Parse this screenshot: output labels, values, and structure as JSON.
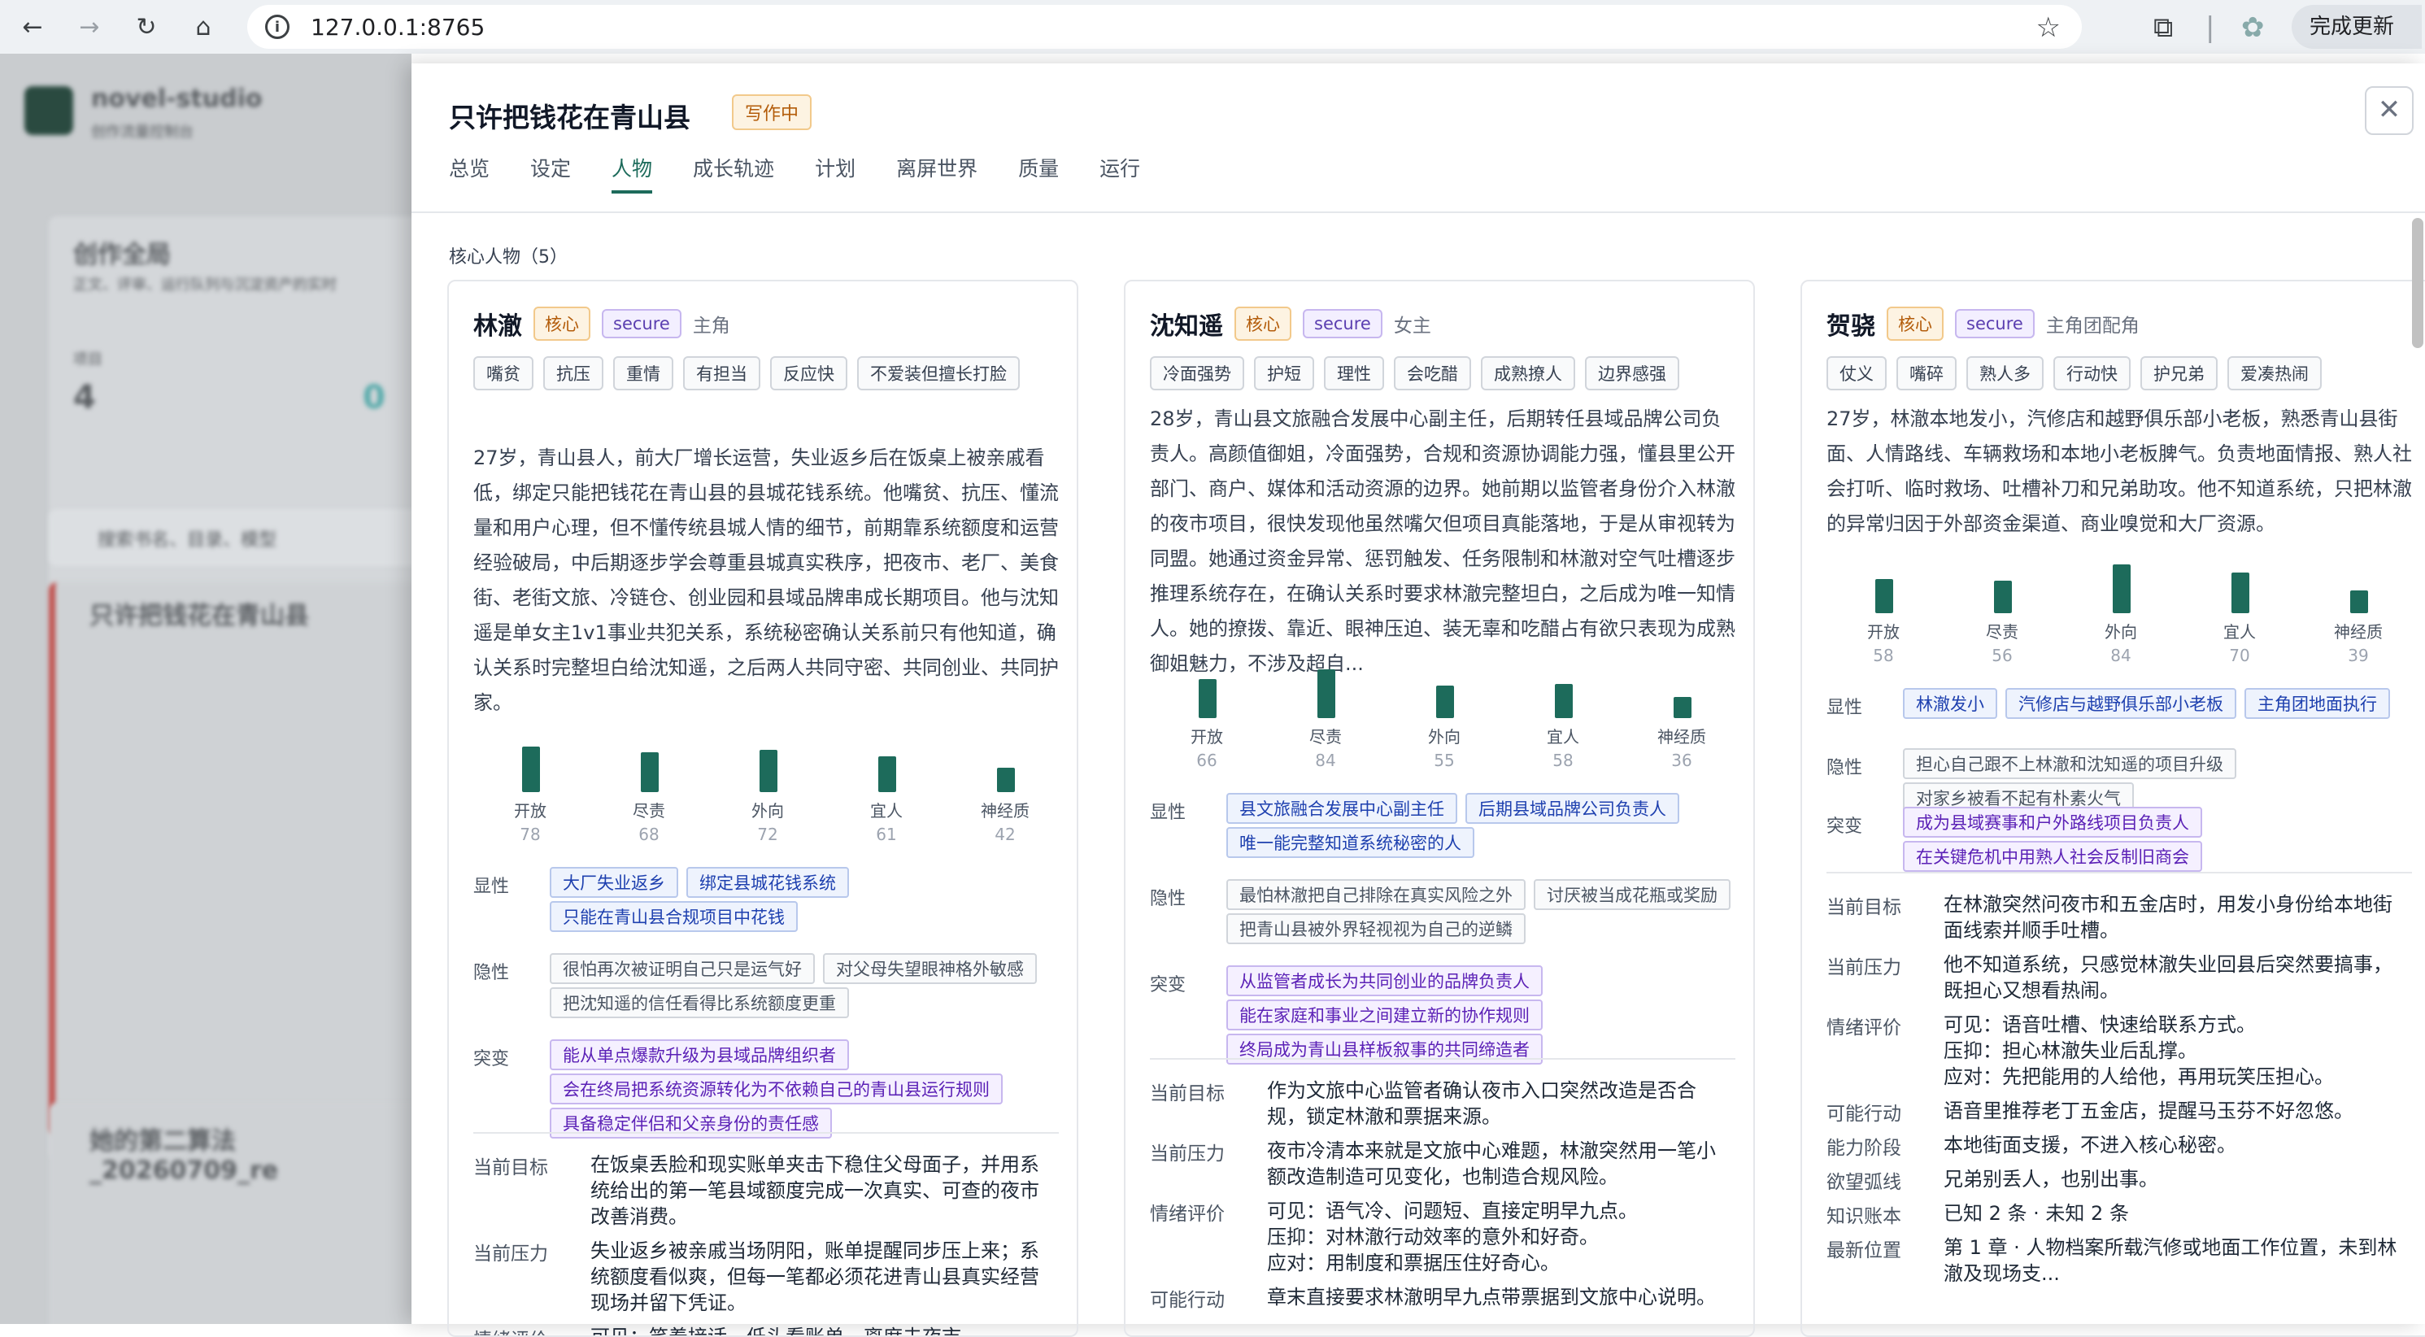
{
  "browser": {
    "url": "127.0.0.1:8765",
    "update_label": "完成更新"
  },
  "panel": {
    "title": "只许把钱花在青山县",
    "status": "写作中",
    "tabs": [
      "总览",
      "设定",
      "人物",
      "成长轨迹",
      "计划",
      "离屏世界",
      "质量",
      "运行"
    ],
    "active_tab": "人物",
    "section_title": "核心人物（5）"
  },
  "background_app": {
    "app_name": "novel-studio",
    "app_sub": "创作流量控制台",
    "section": "创作全局",
    "section_sub": "正文、评审、运行队列与沉淀资产的实时",
    "stat_label": "项目",
    "stat_value": "4",
    "stat_value2": "0",
    "search_placeholder": "搜索书名、目录、模型",
    "project1": "只许把钱花在青山县",
    "project2": "她的第二算法_20260709_re"
  },
  "characters": [
    {
      "name": "林澈",
      "core": "核心",
      "attach": "secure",
      "role": "主角",
      "tags": [
        "嘴贫",
        "抗压",
        "重情",
        "有担当",
        "反应快",
        "不爱装但擅长打脸"
      ],
      "desc": "27岁，青山县人，前大厂增长运营，失业返乡后在饭桌上被亲戚看低，绑定只能把钱花在青山县的县城花钱系统。他嘴贫、抗压、懂流量和用户心理，但不懂传统县城人情的细节，前期靠系统额度和运营经验破局，中后期逐步学会尊重县城真实秩序，把夜市、老厂、美食街、老街文旅、冷链仓、创业园和县域品牌串成长期项目。他与沈知遥是单女主1v1事业共犯关系，系统秘密确认关系前只有他知道，确认关系时完整坦白给沈知遥，之后两人共同守密、共同创业、共同护家。",
      "bars": [
        {
          "label": "开放",
          "value": 78
        },
        {
          "label": "尽责",
          "value": 68
        },
        {
          "label": "外向",
          "value": 72
        },
        {
          "label": "宜人",
          "value": 61
        },
        {
          "label": "神经质",
          "value": 42
        }
      ],
      "traits": [
        {
          "label": "显性",
          "style": "b",
          "items": [
            "大厂失业返乡",
            "绑定县城花钱系统",
            "只能在青山县合规项目中花钱"
          ]
        },
        {
          "label": "隐性",
          "style": "g",
          "items": [
            "很怕再次被证明自己只是运气好",
            "对父母失望眼神格外敏感",
            "把沈知遥的信任看得比系统额度更重"
          ]
        },
        {
          "label": "突变",
          "style": "p",
          "items": [
            "能从单点爆款升级为县域品牌组织者",
            "会在终局把系统资源转化为不依赖自己的青山县运行规则",
            "具备稳定伴侣和父亲身份的责任感"
          ]
        }
      ],
      "kv": [
        {
          "k": "当前目标",
          "v": "在饭桌丢脸和现实账单夹击下稳住父母面子，并用系统给出的第一笔县域额度完成一次真实、可查的夜市改善消费。"
        },
        {
          "k": "当前压力",
          "v": "失业返乡被亲戚当场阴阳，账单提醒同步压上来；系统额度看似爽，但每一笔都必须花进青山县真实经营现场并留下凭证。"
        },
        {
          "k": "情绪评价",
          "v": "可见：笑着接话、低头看账单、离席去夜市。"
        }
      ]
    },
    {
      "name": "沈知遥",
      "core": "核心",
      "attach": "secure",
      "role": "女主",
      "tags": [
        "冷面强势",
        "护短",
        "理性",
        "会吃醋",
        "成熟撩人",
        "边界感强"
      ],
      "desc": "28岁，青山县文旅融合发展中心副主任，后期转任县域品牌公司负责人。高颜值御姐，冷面强势，合规和资源协调能力强，懂县里公开部门、商户、媒体和活动资源的边界。她前期以监管者身份介入林澈的夜市项目，很快发现他虽然嘴欠但项目真能落地，于是从审视转为同盟。她通过资金异常、惩罚触发、任务限制和林澈对空气吐槽逐步推理系统存在，在确认关系时要求林澈完整坦白，之后成为唯一知情人。她的撩拨、靠近、眼神压迫、装无辜和吃醋占有欲只表现为成熟御姐魅力，不涉及超自...",
      "bars": [
        {
          "label": "开放",
          "value": 66
        },
        {
          "label": "尽责",
          "value": 84
        },
        {
          "label": "外向",
          "value": 55
        },
        {
          "label": "宜人",
          "value": 58
        },
        {
          "label": "神经质",
          "value": 36
        }
      ],
      "traits": [
        {
          "label": "显性",
          "style": "b",
          "items": [
            "县文旅融合发展中心副主任",
            "后期县域品牌公司负责人",
            "唯一能完整知道系统秘密的人"
          ]
        },
        {
          "label": "隐性",
          "style": "g",
          "items": [
            "最怕林澈把自己排除在真实风险之外",
            "讨厌被当成花瓶或奖励",
            "把青山县被外界轻视视为自己的逆鳞"
          ]
        },
        {
          "label": "突变",
          "style": "p",
          "items": [
            "从监管者成长为共同创业的品牌负责人",
            "能在家庭和事业之间建立新的协作规则",
            "终局成为青山县样板叙事的共同缔造者"
          ]
        }
      ],
      "kv": [
        {
          "k": "当前目标",
          "v": "作为文旅中心监管者确认夜市入口突然改造是否合规，锁定林澈和票据来源。"
        },
        {
          "k": "当前压力",
          "v": "夜市冷清本来就是文旅中心难题，林澈突然用一笔小额改造制造可见变化，也制造合规风险。"
        },
        {
          "k": "情绪评价",
          "v": "可见：语气冷、问题短、直接定明早九点。\n压抑：对林澈行动效率的意外和好奇。\n应对：用制度和票据压住好奇心。"
        },
        {
          "k": "可能行动",
          "v": "章末直接要求林澈明早九点带票据到文旅中心说明。"
        }
      ]
    },
    {
      "name": "贺骁",
      "core": "核心",
      "attach": "secure",
      "role": "主角团配角",
      "tags": [
        "仗义",
        "嘴碎",
        "熟人多",
        "行动快",
        "护兄弟",
        "爱凑热闹"
      ],
      "desc": "27岁，林澈本地发小，汽修店和越野俱乐部小老板，熟悉青山县街面、人情路线、车辆救场和本地小老板脾气。负责地面情报、熟人社会打听、临时救场、吐槽补刀和兄弟助攻。他不知道系统，只把林澈的异常归因于外部资金渠道、商业嗅觉和大厂资源。",
      "bars": [
        {
          "label": "开放",
          "value": 58
        },
        {
          "label": "尽责",
          "value": 56
        },
        {
          "label": "外向",
          "value": 84
        },
        {
          "label": "宜人",
          "value": 70
        },
        {
          "label": "神经质",
          "value": 39
        }
      ],
      "traits": [
        {
          "label": "显性",
          "style": "b",
          "items": [
            "林澈发小",
            "汽修店与越野俱乐部小老板",
            "主角团地面执行"
          ]
        },
        {
          "label": "隐性",
          "style": "g",
          "items": [
            "担心自己跟不上林澈和沈知遥的项目升级",
            "对家乡被看不起有朴素火气"
          ]
        },
        {
          "label": "突变",
          "style": "p",
          "items": [
            "成为县域赛事和户外路线项目负责人",
            "在关键危机中用熟人社会反制旧商会"
          ]
        }
      ],
      "kv": [
        {
          "k": "当前目标",
          "v": "在林澈突然问夜市和五金店时，用发小身份给本地街面线索并顺手吐槽。"
        },
        {
          "k": "当前压力",
          "v": "他不知道系统，只感觉林澈失业回县后突然要搞事，既担心又想看热闹。"
        },
        {
          "k": "情绪评价",
          "v": "可见：语音吐槽、快速给联系方式。\n压抑：担心林澈失业后乱撑。\n应对：先把能用的人给他，再用玩笑压担心。"
        },
        {
          "k": "可能行动",
          "v": "语音里推荐老丁五金店，提醒马玉芬不好忽悠。"
        },
        {
          "k": "能力阶段",
          "v": "本地街面支援，不进入核心秘密。"
        },
        {
          "k": "欲望弧线",
          "v": "兄弟别丢人，也别出事。"
        },
        {
          "k": "知识账本",
          "v": "已知 2 条 · 未知 2 条"
        },
        {
          "k": "最新位置",
          "v": "第 1 章 · 人物档案所载汽修或地面工作位置，未到林澈及现场支..."
        }
      ]
    }
  ]
}
